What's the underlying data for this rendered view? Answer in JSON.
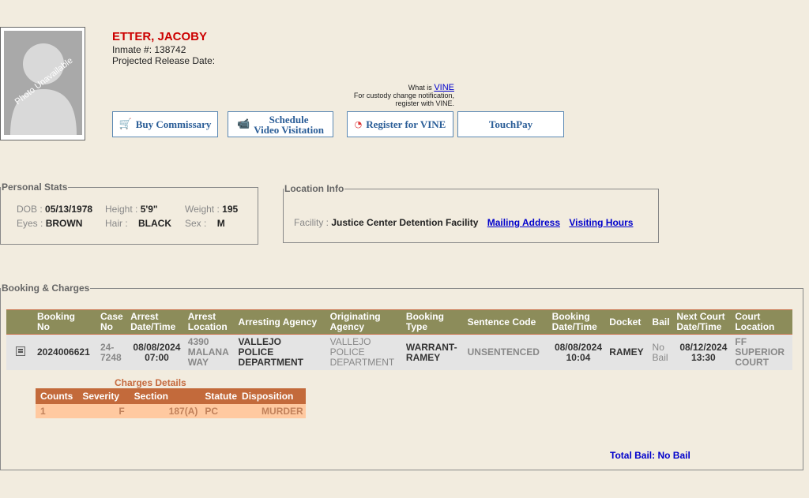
{
  "inmate": {
    "photo_text": "Photo Unavailable",
    "name": "ETTER, JACOBY",
    "inmate_number_label": "Inmate #: 138742",
    "release_label": "Projected Release Date:"
  },
  "vine": {
    "question": "What is",
    "link": "VINE",
    "note_line1": "For custody change notification,",
    "note_line2": "register with VINE."
  },
  "buttons": {
    "commissary": "Buy Commissary",
    "schedule_line1": "Schedule",
    "schedule_line2": "Video Visitation",
    "register_vine": "Register for VINE",
    "touchpay": "TouchPay"
  },
  "personal": {
    "legend": "Personal Stats",
    "dob_label": "DOB :",
    "dob": "05/13/1978",
    "height_label": "Height :",
    "height": "5'9\"",
    "weight_label": "Weight :",
    "weight": "195",
    "eyes_label": "Eyes :",
    "eyes": "BROWN",
    "hair_label": "Hair :",
    "hair": "BLACK",
    "sex_label": "Sex :",
    "sex": "M"
  },
  "location": {
    "legend": "Location Info",
    "facility_label": "Facility :",
    "facility": "Justice Center Detention Facility",
    "mailing": "Mailing Address",
    "visiting": "Visiting Hours"
  },
  "booking": {
    "legend": "Booking & Charges",
    "headers": [
      [
        "Booking",
        "No"
      ],
      [
        "Case",
        "No"
      ],
      [
        "Arrest",
        "Date/Time"
      ],
      [
        "Arrest",
        "Location"
      ],
      [
        "Arresting Agency"
      ],
      [
        "Originating",
        "Agency"
      ],
      [
        "Booking",
        "Type"
      ],
      [
        "Sentence Code"
      ],
      [
        "Booking",
        "Date/Time"
      ],
      [
        "Docket"
      ],
      [
        "Bail"
      ],
      [
        "Next Court",
        "Date/Time"
      ],
      [
        "Court",
        "Location"
      ]
    ],
    "row": {
      "booking_no": "2024006621",
      "case_no": [
        "24-",
        "7248"
      ],
      "arrest_dt": [
        "08/08/2024",
        "07:00"
      ],
      "arrest_loc": [
        "4390",
        "MALANA",
        "WAY"
      ],
      "arresting_agency": [
        "VALLEJO",
        "POLICE",
        "DEPARTMENT"
      ],
      "originating_agency": [
        "VALLEJO",
        "POLICE",
        "DEPARTMENT"
      ],
      "booking_type": [
        "WARRANT-",
        "RAMEY"
      ],
      "sentence_code": "UNSENTENCED",
      "booking_dt": [
        "08/08/2024",
        "10:04"
      ],
      "docket": "RAMEY",
      "bail": [
        "No",
        "Bail"
      ],
      "next_court": [
        "08/12/2024",
        "13:30"
      ],
      "court_loc": [
        "FF",
        "SUPERIOR",
        "COURT"
      ]
    },
    "charges_title": "Charges Details",
    "charges_headers": [
      "Counts",
      "Severity",
      "Section",
      "Statute",
      "Disposition"
    ],
    "charges_row": [
      "1",
      "F",
      "187(A)",
      "PC",
      "MURDER"
    ],
    "total_bail": "Total Bail: No Bail"
  }
}
